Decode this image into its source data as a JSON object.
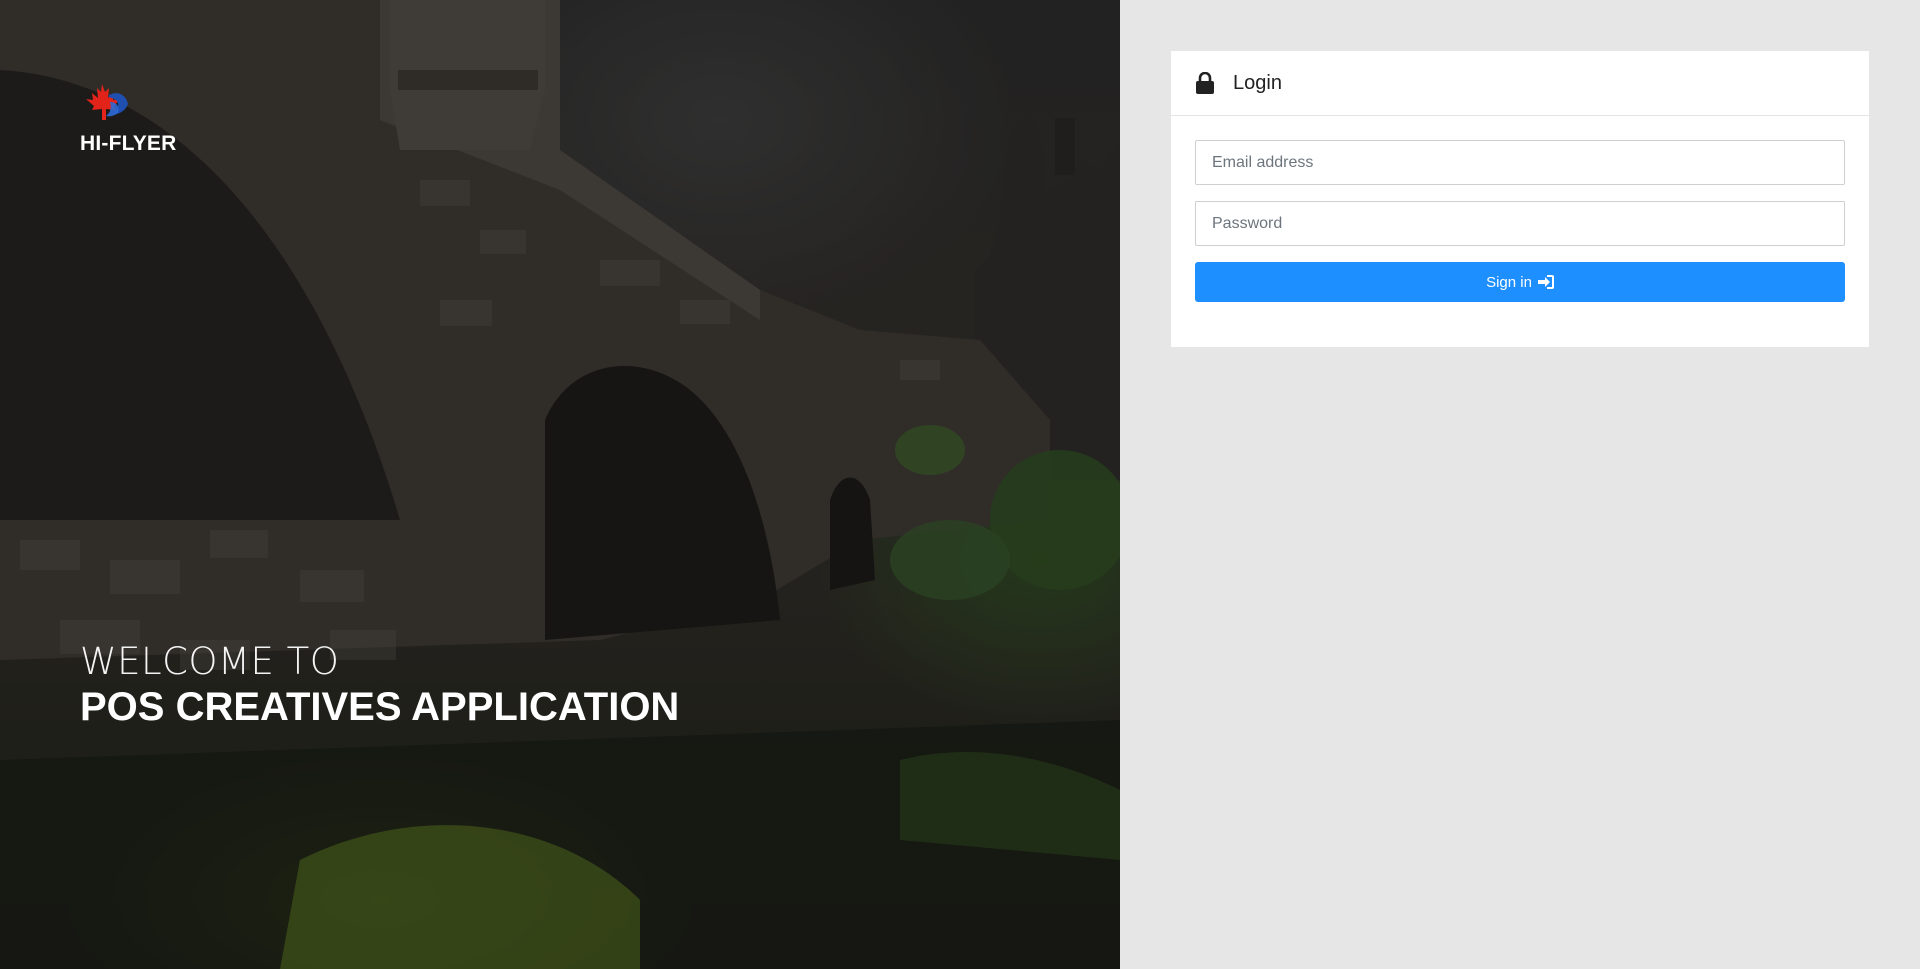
{
  "brand": {
    "name": "HI-FLYER",
    "logo_icon": "maple-leaf-logo-icon"
  },
  "hero": {
    "welcome_line1": "WELCOME TO",
    "welcome_line2": "POS CREATIVES APPLICATION",
    "background": "stone-bridge-photo"
  },
  "login": {
    "title": "Login",
    "title_icon": "lock-icon",
    "email": {
      "placeholder": "Email address",
      "value": ""
    },
    "password": {
      "placeholder": "Password",
      "value": ""
    },
    "signin_label": "Sign in",
    "signin_icon": "sign-in-icon"
  },
  "colors": {
    "accent": "#1e8ffe",
    "page_background": "#e6e6e6",
    "card_background": "#ffffff",
    "text_light": "#ffffff"
  }
}
